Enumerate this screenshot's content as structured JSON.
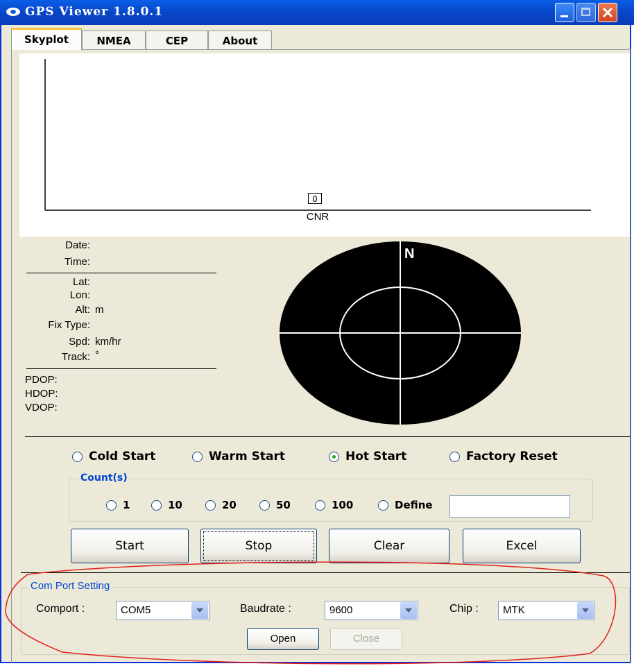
{
  "window": {
    "title": "GPS Viewer 1.8.0.1"
  },
  "tabs": [
    {
      "label": "Skyplot"
    },
    {
      "label": "NMEA"
    },
    {
      "label": "CEP"
    },
    {
      "label": "About"
    }
  ],
  "cnr_chart": {
    "bar_value": "0",
    "xlabel": "CNR"
  },
  "info": {
    "date_label": "Date:",
    "time_label": "Time:",
    "lat_label": "Lat:",
    "lon_label": "Lon:",
    "alt_label": "Alt:",
    "alt_unit": "m",
    "fix_label": "Fix Type:",
    "spd_label": "Spd:",
    "spd_unit": "km/hr",
    "track_label": "Track:",
    "track_unit": "°",
    "pdop_label": "PDOP:",
    "hdop_label": "HDOP:",
    "vdop_label": "VDOP:"
  },
  "skyplot": {
    "north_label": "N"
  },
  "start_modes": [
    {
      "label": "Cold Start",
      "selected": false
    },
    {
      "label": "Warm Start",
      "selected": false
    },
    {
      "label": "Hot Start",
      "selected": true
    },
    {
      "label": "Factory Reset",
      "selected": false
    }
  ],
  "counts": {
    "legend": "Count(s)",
    "options": [
      "1",
      "10",
      "20",
      "50",
      "100",
      "Define"
    ],
    "define_value": ""
  },
  "actions": {
    "start": "Start",
    "stop": "Stop",
    "clear": "Clear",
    "excel": "Excel"
  },
  "com": {
    "legend": "Com Port Setting",
    "comport_label": "Comport :",
    "comport_value": "COM5",
    "baud_label": "Baudrate :",
    "baud_value": "9600",
    "chip_label": "Chip :",
    "chip_value": "MTK",
    "open": "Open",
    "close": "Close"
  },
  "colors": {
    "titlebar": "#0846c8",
    "window_bg": "#ece9d8",
    "legend_text": "#0046d5",
    "annotation": "#e0201c"
  }
}
